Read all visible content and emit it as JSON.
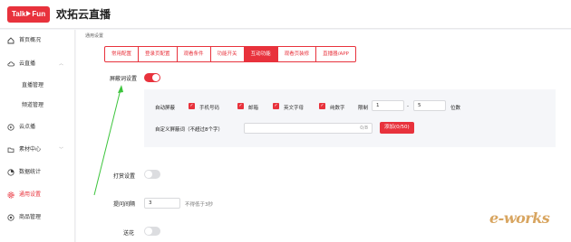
{
  "header": {
    "logo_text": "Talk",
    "logo_text2": "Fun",
    "title": "欢拓云直播"
  },
  "sidebar": {
    "items": [
      {
        "label": "首页概况",
        "icon": "home-icon"
      },
      {
        "label": "云直播",
        "icon": "cloud-icon",
        "chevron": "︿"
      },
      {
        "label": "直播管理"
      },
      {
        "label": "频道管理"
      },
      {
        "label": "云点播",
        "icon": "play-icon"
      },
      {
        "label": "素材中心",
        "icon": "folder-icon",
        "chevron": "﹀"
      },
      {
        "label": "数据统计",
        "icon": "chart-icon"
      },
      {
        "label": "通用设置",
        "icon": "gear-icon",
        "active": true
      },
      {
        "label": "商品管理",
        "icon": "shop-icon"
      }
    ]
  },
  "main": {
    "breadcrumb": "通用设置",
    "tabs": [
      {
        "label": "常用配置"
      },
      {
        "label": "登录页配置"
      },
      {
        "label": "观看条件"
      },
      {
        "label": "功能开关"
      },
      {
        "label": "互动功能",
        "active": true
      },
      {
        "label": "观看页装修"
      },
      {
        "label": "直播器/APP"
      }
    ],
    "block_words": {
      "label": "屏蔽词设置",
      "enabled": true
    },
    "auto_block": {
      "label": "自动屏蔽",
      "options": [
        "手机号码",
        "邮箱",
        "英文字母",
        "纯数字"
      ],
      "limit_label": "限制",
      "limit_min": "1",
      "dash": "-",
      "limit_max": "5",
      "unit": "位数"
    },
    "custom_words": {
      "label": "自定义屏蔽词（不超过8个字）",
      "counter": "0/8",
      "add_button": "添加(0/50)"
    },
    "tip_setting": {
      "label": "打赏设置",
      "enabled": false
    },
    "question_interval": {
      "label": "提问间隔",
      "value": "3",
      "hint": "不得低于3秒"
    },
    "gift": {
      "label": "送花",
      "enabled": false
    }
  },
  "watermark": {
    "text": "e-works"
  },
  "colors": {
    "accent": "#e8323c",
    "annotation_arrow": "#3cc43c"
  }
}
